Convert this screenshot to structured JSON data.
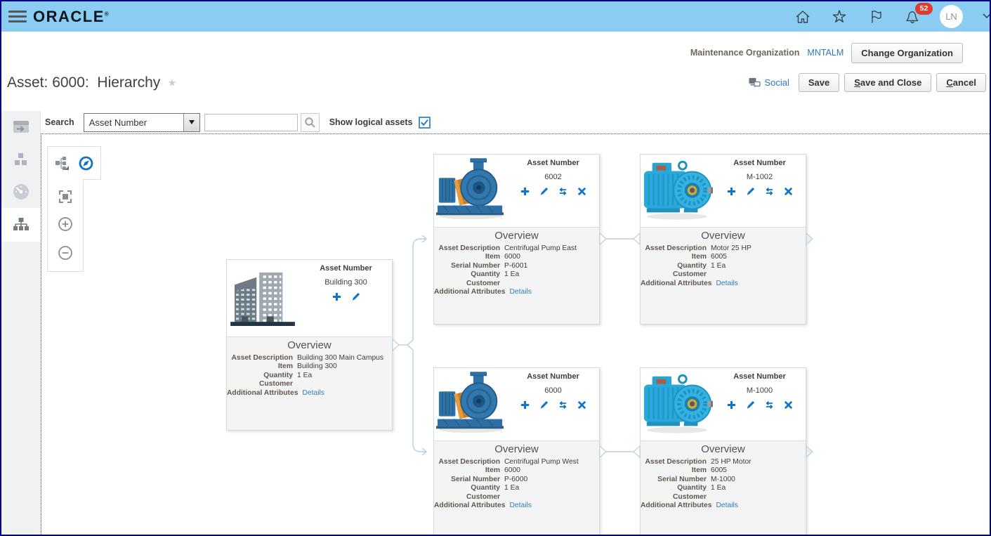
{
  "topbar": {
    "brand": "ORACLE",
    "brand_mark": "®",
    "notification_count": "52",
    "avatar_initials": "LN"
  },
  "context_bar": {
    "org_label": "Maintenance Organization",
    "org_value": "MNTALM",
    "change_org_button": "Change Organization"
  },
  "page_header": {
    "title": "Asset: 6000:  Hierarchy",
    "social_label": "Social",
    "save_button": "Save",
    "save_and_close_button": "Save and Close",
    "cancel_button": "Cancel"
  },
  "search_bar": {
    "label": "Search",
    "category_selected": "Asset Number",
    "input_value": "",
    "input_placeholder": "",
    "show_logical_label": "Show logical assets",
    "show_logical_checked": true
  },
  "card_common": {
    "asset_number_label": "Asset Number",
    "overview_label": "Overview"
  },
  "cards": [
    {
      "id": "building-300",
      "image": "building",
      "asset_number": "Building 300",
      "actions": [
        "add",
        "edit"
      ],
      "fields": [
        {
          "label": "Asset Description",
          "value": "Building 300 Main Campus"
        },
        {
          "label": "Item",
          "value": "Building 300"
        },
        {
          "label": "Quantity",
          "value": "1 Ea"
        },
        {
          "label": "Customer",
          "value": ""
        },
        {
          "label": "Additional Attributes",
          "value": "Details",
          "link": true
        }
      ]
    },
    {
      "id": "pump-6002",
      "image": "pump",
      "asset_number": "6002",
      "actions": [
        "add",
        "edit",
        "swap",
        "delete"
      ],
      "fields": [
        {
          "label": "Asset Description",
          "value": "Centrifugal Pump East"
        },
        {
          "label": "Item",
          "value": "6000"
        },
        {
          "label": "Serial Number",
          "value": "P-6001"
        },
        {
          "label": "Quantity",
          "value": "1 Ea"
        },
        {
          "label": "Customer",
          "value": ""
        },
        {
          "label": "Additional Attributes",
          "value": "Details",
          "link": true
        }
      ]
    },
    {
      "id": "motor-m1002",
      "image": "motor",
      "asset_number": "M-1002",
      "actions": [
        "add",
        "edit",
        "swap",
        "delete"
      ],
      "fields": [
        {
          "label": "Asset Description",
          "value": "Motor 25 HP"
        },
        {
          "label": "Item",
          "value": "6005"
        },
        {
          "label": "Quantity",
          "value": "1 Ea"
        },
        {
          "label": "Customer",
          "value": ""
        },
        {
          "label": "Additional Attributes",
          "value": "Details",
          "link": true
        }
      ]
    },
    {
      "id": "pump-6000",
      "image": "pump",
      "asset_number": "6000",
      "actions": [
        "add",
        "edit",
        "swap",
        "delete"
      ],
      "fields": [
        {
          "label": "Asset Description",
          "value": "Centrifugal Pump West"
        },
        {
          "label": "Item",
          "value": "6000"
        },
        {
          "label": "Serial Number",
          "value": "P-6000"
        },
        {
          "label": "Quantity",
          "value": "1 Ea"
        },
        {
          "label": "Customer",
          "value": ""
        },
        {
          "label": "Additional Attributes",
          "value": "Details",
          "link": true
        }
      ]
    },
    {
      "id": "motor-m1000",
      "image": "motor",
      "asset_number": "M-1000",
      "actions": [
        "add",
        "edit",
        "swap",
        "delete"
      ],
      "fields": [
        {
          "label": "Asset Description",
          "value": "25 HP Motor"
        },
        {
          "label": "Item",
          "value": "6005"
        },
        {
          "label": "Serial Number",
          "value": "M-1000"
        },
        {
          "label": "Quantity",
          "value": "1 Ea"
        },
        {
          "label": "Customer",
          "value": ""
        },
        {
          "label": "Additional Attributes",
          "value": "Details",
          "link": true
        }
      ]
    }
  ],
  "colors": {
    "topbar_bg": "#8BCDF2",
    "accent_blue": "#1273C8",
    "link_blue": "#2D7BB9",
    "badge_red": "#E23A2E"
  }
}
